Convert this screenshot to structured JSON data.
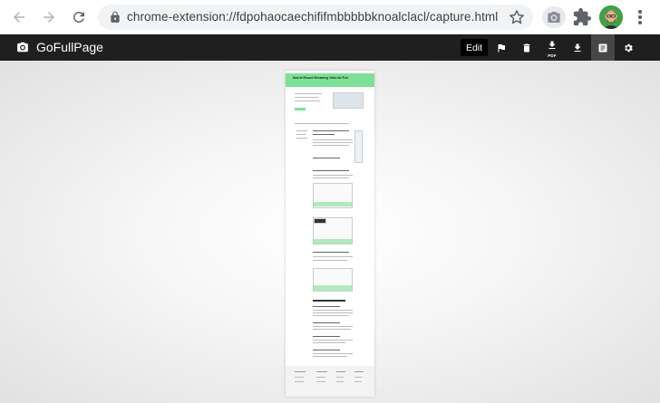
{
  "browser": {
    "url": "chrome-extension://fdpohaocaechififmbbbbbknoalclacl/capture.html",
    "back_icon": "arrow-left-icon",
    "forward_icon": "arrow-right-icon",
    "reload_icon": "reload-icon",
    "lock_icon": "lock-icon",
    "bookmark_icon": "star-icon",
    "extension_icon": "camera-icon",
    "extensions_menu_icon": "puzzle-icon",
    "menu_icon": "kebab-icon"
  },
  "app": {
    "title": "GoFullPage",
    "edit_label": "Edit",
    "tools": [
      {
        "name": "flag-icon"
      },
      {
        "name": "trash-icon"
      },
      {
        "name": "download-pdf-icon",
        "label": "PDF"
      },
      {
        "name": "download-icon"
      },
      {
        "name": "document-icon",
        "active": true
      },
      {
        "name": "gear-icon"
      }
    ]
  },
  "preview": {
    "page_title": "How to Record Streaming Video for Free",
    "accent": "#7ee096"
  }
}
